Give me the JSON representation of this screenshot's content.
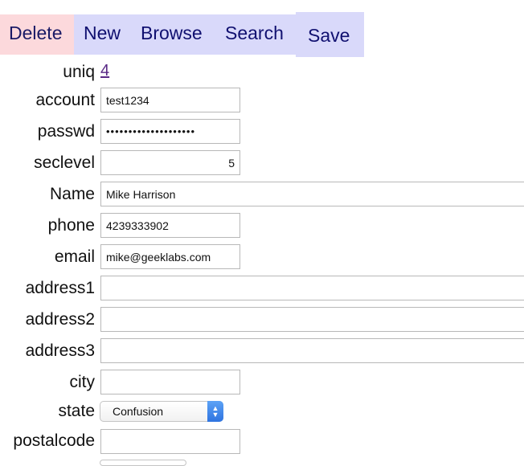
{
  "toolbar": {
    "delete_label": "Delete",
    "new_label": "New",
    "browse_label": "Browse",
    "search_label": "Search",
    "save_label": "Save"
  },
  "form": {
    "uniq": {
      "label": "uniq",
      "value": "4"
    },
    "account": {
      "label": "account",
      "value": "test1234"
    },
    "passwd": {
      "label": "passwd",
      "value": "••••••••••••••••••••"
    },
    "seclevel": {
      "label": "seclevel",
      "value": "5"
    },
    "name": {
      "label": "Name",
      "value": "Mike Harrison"
    },
    "phone": {
      "label": "phone",
      "value": "4239333902"
    },
    "email": {
      "label": "email",
      "value": "mike@geeklabs.com"
    },
    "address1": {
      "label": "address1",
      "value": ""
    },
    "address2": {
      "label": "address2",
      "value": ""
    },
    "address3": {
      "label": "address3",
      "value": ""
    },
    "city": {
      "label": "city",
      "value": ""
    },
    "state": {
      "label": "state",
      "value": "Confusion"
    },
    "postalcode": {
      "label": "postalcode",
      "value": ""
    }
  },
  "colors": {
    "delete_bg": "#fcd9dc",
    "nav_bg": "#d9d9fa",
    "toolbar_text": "#101070",
    "link": "#5a2a86",
    "select_accent": "#2f74e0"
  },
  "icons": {
    "state_select": "chevron-up-down-icon"
  }
}
